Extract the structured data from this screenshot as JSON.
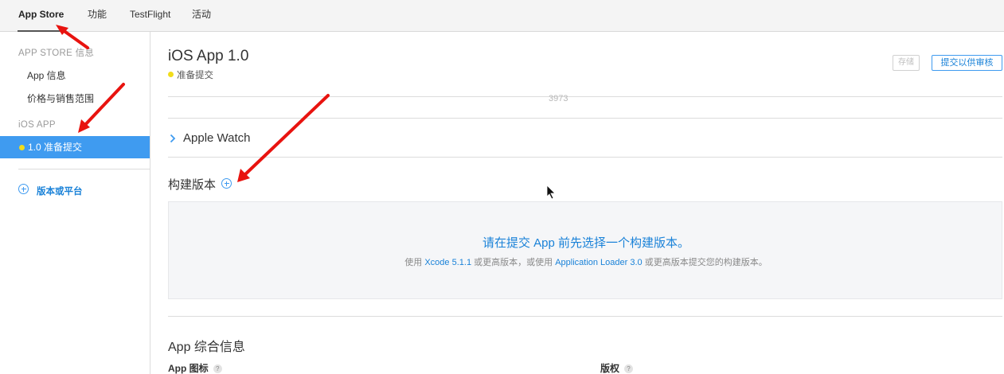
{
  "topbar": {
    "tabs": [
      {
        "label": "App Store",
        "active": true
      },
      {
        "label": "功能",
        "active": false
      },
      {
        "label": "TestFlight",
        "active": false
      },
      {
        "label": "活动",
        "active": false
      }
    ]
  },
  "sidebar": {
    "section_appstore": "APP STORE 信息",
    "items_appstore": [
      "App 信息",
      "价格与销售范围"
    ],
    "section_ios": "iOS APP",
    "selected_version": "1.0 准备提交",
    "add_version_label": "版本或平台"
  },
  "main": {
    "title": "iOS App 1.0",
    "status": "准备提交",
    "save_button": "存储",
    "submit_button": "提交以供审核",
    "count": "3973",
    "apple_watch_label": "Apple Watch",
    "build_label": "构建版本",
    "build_prompt": "请在提交 App 前先选择一个构建版本。",
    "build_hint": {
      "prefix": "使用 ",
      "xcode_link": "Xcode 5.1.1",
      "middle": " 或更高版本，或使用 ",
      "loader_link": "Application Loader 3.0",
      "suffix": " 或更高版本提交您的构建版本。"
    },
    "general_info_title": "App 综合信息",
    "field_app_icon": "App 图标",
    "field_copyright": "版权",
    "help_glyph": "?"
  },
  "colors": {
    "accent_blue": "#3f9bf0",
    "status_yellow": "#f1dc1a",
    "annotation_red": "#e8130f"
  }
}
